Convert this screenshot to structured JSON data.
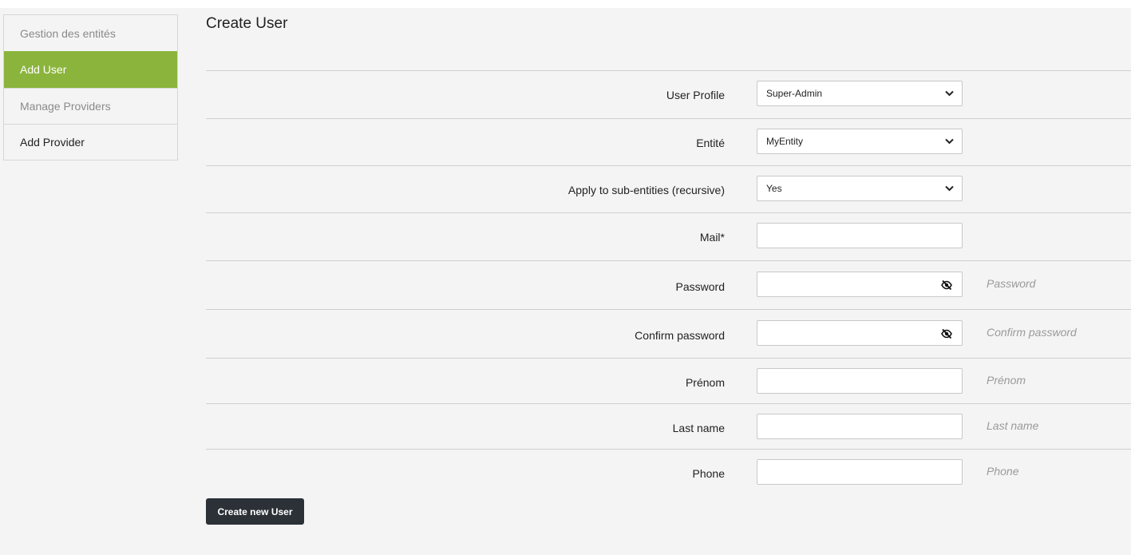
{
  "sidebar": {
    "items": [
      {
        "label": "Gestion des entités"
      },
      {
        "label": "Add User"
      },
      {
        "label": "Manage Providers"
      },
      {
        "label": "Add Provider"
      }
    ]
  },
  "page": {
    "title": "Create User"
  },
  "form": {
    "user_profile": {
      "label": "User Profile",
      "value": "Super-Admin"
    },
    "entity": {
      "label": "Entité",
      "value": "MyEntity"
    },
    "recursive": {
      "label": "Apply to sub-entities (recursive)",
      "value": "Yes"
    },
    "mail": {
      "label": "Mail*",
      "value": ""
    },
    "password": {
      "label": "Password",
      "value": "",
      "hint": "Password"
    },
    "confirm_password": {
      "label": "Confirm password",
      "value": "",
      "hint": "Confirm password"
    },
    "first_name": {
      "label": "Prénom",
      "value": "",
      "hint": "Prénom"
    },
    "last_name": {
      "label": "Last name",
      "value": "",
      "hint": "Last name"
    },
    "phone": {
      "label": "Phone",
      "value": "",
      "hint": "Phone"
    }
  },
  "actions": {
    "submit_label": "Create new User"
  },
  "icons": {
    "select_arrow": "chevron-down-icon",
    "password_toggle": "eye-slash-icon"
  },
  "colors": {
    "active_sidebar": "#8bb43c",
    "button": "#2b3137"
  }
}
